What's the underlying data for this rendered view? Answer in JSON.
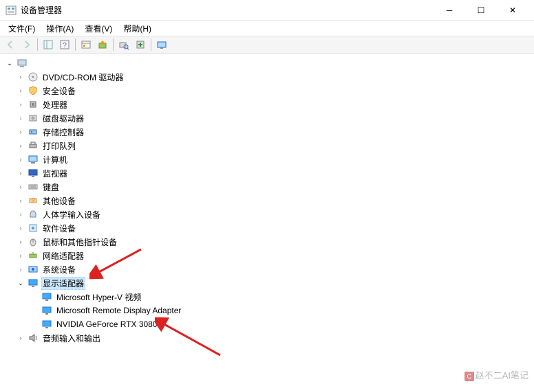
{
  "window": {
    "title": "设备管理器"
  },
  "menu": {
    "file": "文件(F)",
    "action": "操作(A)",
    "view": "查看(V)",
    "help": "帮助(H)"
  },
  "tree": {
    "root": "",
    "categories": [
      {
        "label": "DVD/CD-ROM 驱动器",
        "icon": "disc"
      },
      {
        "label": "安全设备",
        "icon": "shield"
      },
      {
        "label": "处理器",
        "icon": "cpu"
      },
      {
        "label": "磁盘驱动器",
        "icon": "disk"
      },
      {
        "label": "存储控制器",
        "icon": "storage"
      },
      {
        "label": "打印队列",
        "icon": "printer"
      },
      {
        "label": "计算机",
        "icon": "computer"
      },
      {
        "label": "监视器",
        "icon": "monitor"
      },
      {
        "label": "键盘",
        "icon": "keyboard"
      },
      {
        "label": "其他设备",
        "icon": "other"
      },
      {
        "label": "人体学输入设备",
        "icon": "hid"
      },
      {
        "label": "软件设备",
        "icon": "software"
      },
      {
        "label": "鼠标和其他指针设备",
        "icon": "mouse"
      },
      {
        "label": "网络适配器",
        "icon": "network"
      },
      {
        "label": "系统设备",
        "icon": "system"
      },
      {
        "label": "显示适配器",
        "icon": "display",
        "expanded": true,
        "selected": true,
        "children": [
          {
            "label": "Microsoft Hyper-V 视频"
          },
          {
            "label": "Microsoft Remote Display Adapter"
          },
          {
            "label": "NVIDIA GeForce RTX 3080"
          }
        ]
      },
      {
        "label": "音频输入和输出",
        "icon": "audio"
      }
    ]
  },
  "watermark": "赵不二AI笔记"
}
